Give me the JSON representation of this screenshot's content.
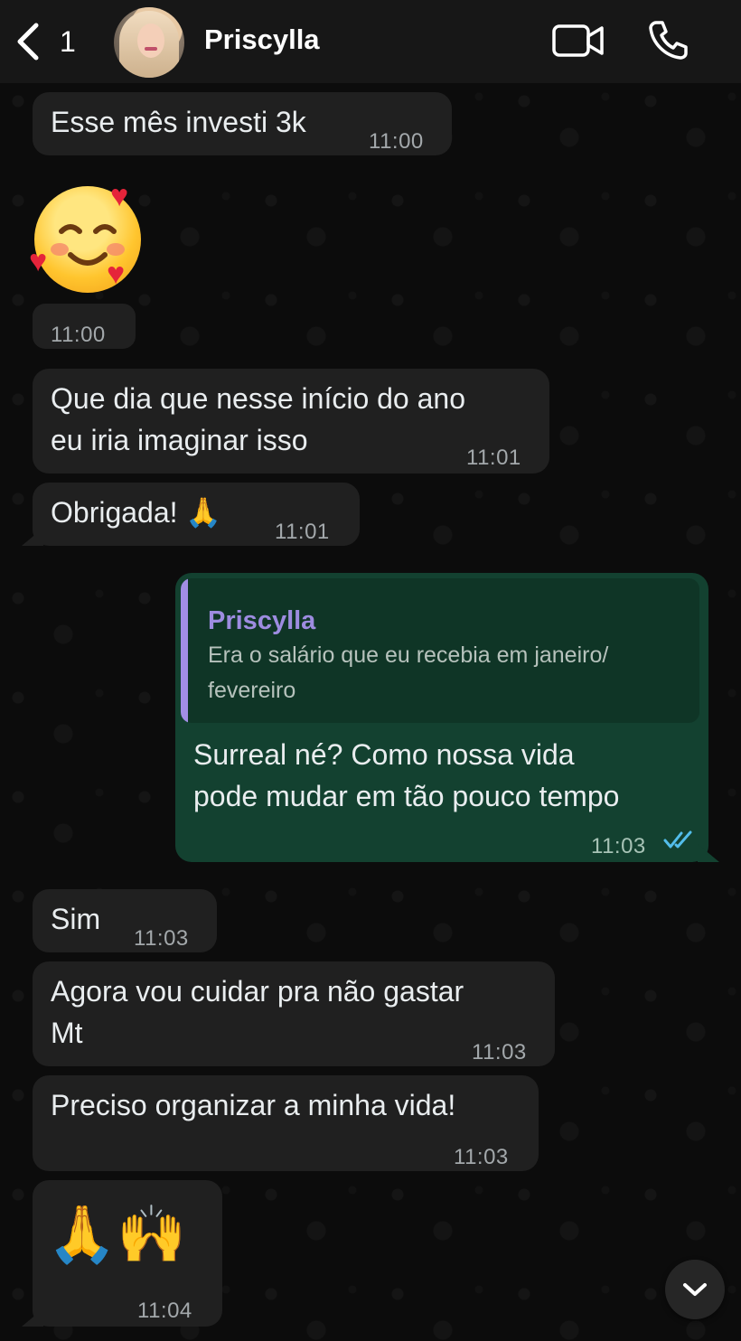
{
  "header": {
    "back_count": "1",
    "contact_name": "Priscylla"
  },
  "messages": [
    {
      "dir": "in",
      "text": "Esse mês investi 3k",
      "time": "11:00"
    },
    {
      "dir": "in",
      "emoji": "smiling-face-with-hearts",
      "time": "11:00"
    },
    {
      "dir": "in",
      "lines": [
        "Que dia que nesse início do ano",
        "eu iria imaginar isso"
      ],
      "time": "11:01"
    },
    {
      "dir": "in",
      "text": "Obrigada! 🙏",
      "time": "11:01"
    },
    {
      "dir": "out",
      "reply_to": {
        "name": "Priscylla",
        "lines": [
          "Era o salário que eu recebia em janeiro/",
          "fevereiro"
        ]
      },
      "lines": [
        "Surreal né? Como nossa vida",
        "pode mudar em tão pouco tempo"
      ],
      "time": "11:03",
      "status": "read"
    },
    {
      "dir": "in",
      "text": "Sim",
      "time": "11:03"
    },
    {
      "dir": "in",
      "lines": [
        "Agora vou cuidar pra não gastar",
        "Mt"
      ],
      "time": "11:03"
    },
    {
      "dir": "in",
      "text": "Preciso organizar a minha vida!",
      "time": "11:03"
    },
    {
      "dir": "in",
      "emoji_text": "🙏🙌",
      "time": "11:04"
    }
  ],
  "colors": {
    "incoming_bubble": "#202020",
    "outgoing_bubble": "#134130",
    "quote_accent": "#a28ee5",
    "read_ticks": "#53bdeb"
  }
}
